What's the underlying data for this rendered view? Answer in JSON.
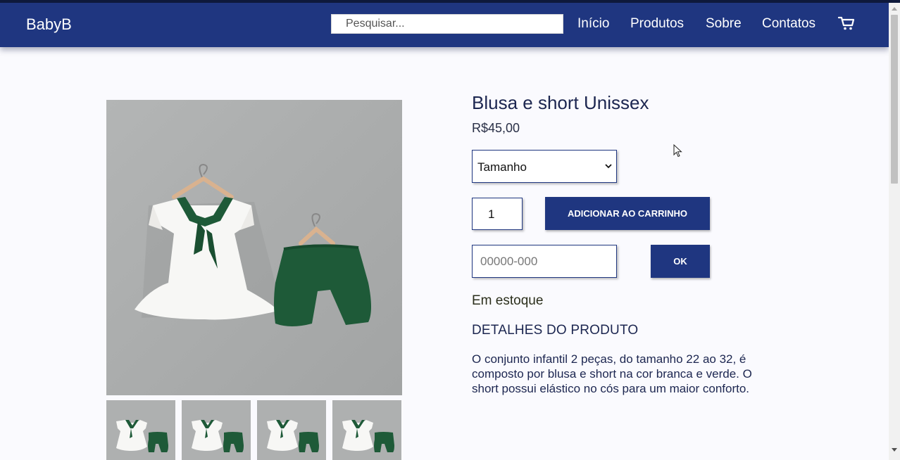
{
  "header": {
    "brand": "BabyB",
    "search_placeholder": "Pesquisar...",
    "nav": [
      "Início",
      "Produtos",
      "Sobre",
      "Contatos"
    ],
    "cart_icon": "cart-icon"
  },
  "product": {
    "title": "Blusa e short Unissex",
    "price": "R$45,00",
    "size_select": {
      "selected": "Tamanho"
    },
    "quantity": "1",
    "add_to_cart_label": "ADICIONAR AO CARRINHO",
    "cep_placeholder": "00000-000",
    "ok_label": "OK",
    "stock_status": "Em estoque",
    "details_heading": "DETALHES DO PRODUTO",
    "description": "O conjunto infantil 2 peças, do tamanho 22 ao 32, é composto por blusa e short na cor branca e verde. O short possui elástico no cós para um maior conforto.",
    "thumbnail_count": 4
  },
  "colors": {
    "header_bg": "#1f3680",
    "button_bg": "#1f3680",
    "page_bg": "#fafafe",
    "photo_bg": "#a9abab",
    "garment_green": "#1e5a38"
  }
}
